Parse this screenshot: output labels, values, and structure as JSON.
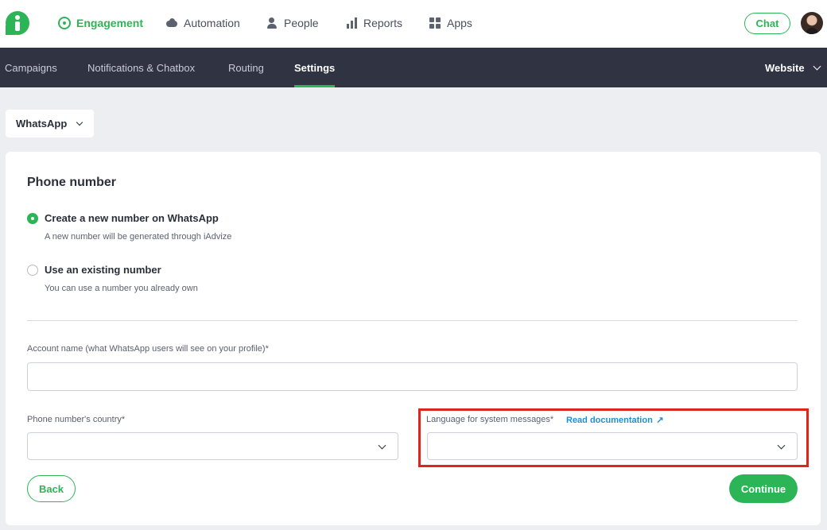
{
  "topnav": {
    "items": [
      {
        "label": "Engagement",
        "icon": "target-icon",
        "active": true
      },
      {
        "label": "Automation",
        "icon": "cloud-icon",
        "active": false
      },
      {
        "label": "People",
        "icon": "person-icon",
        "active": false
      },
      {
        "label": "Reports",
        "icon": "bar-chart-icon",
        "active": false
      },
      {
        "label": "Apps",
        "icon": "apps-grid-icon",
        "active": false
      }
    ],
    "chat_label": "Chat"
  },
  "subnav": {
    "items": [
      {
        "label": "Campaigns",
        "active": false
      },
      {
        "label": "Notifications & Chatbox",
        "active": false
      },
      {
        "label": "Routing",
        "active": false
      },
      {
        "label": "Settings",
        "active": true
      }
    ],
    "website_label": "Website"
  },
  "channel_dropdown": {
    "value": "WhatsApp"
  },
  "card": {
    "title": "Phone number",
    "options": [
      {
        "label": "Create a new number on WhatsApp",
        "description": "A new number will be generated through iAdvize",
        "checked": true
      },
      {
        "label": "Use an existing number",
        "description": "You can use a number you already own",
        "checked": false
      }
    ],
    "account_name": {
      "label": "Account name (what WhatsApp users will see on your profile)*",
      "value": ""
    },
    "country": {
      "label": "Phone number's country*",
      "value": ""
    },
    "language": {
      "label": "Language for system messages*",
      "link": "Read documentation",
      "value": ""
    },
    "back_label": "Back",
    "continue_label": "Continue"
  },
  "colors": {
    "accent": "#2cb557",
    "subnav_bg": "#2f3342",
    "link": "#1e8fd6",
    "highlight": "#e1241b"
  }
}
